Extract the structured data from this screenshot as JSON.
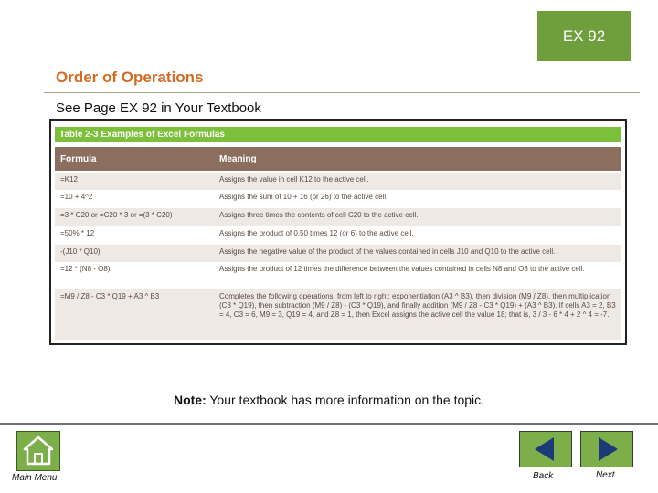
{
  "badge": {
    "text": "EX 92"
  },
  "section_title": "Order of Operations",
  "subtitle": "See Page EX 92 in Your Textbook",
  "table": {
    "title": "Table 2-3 Examples of Excel Formulas",
    "headers": [
      "Formula",
      "Meaning"
    ],
    "rows": [
      {
        "formula": "=K12",
        "meaning": "Assigns the value in cell K12 to the active cell."
      },
      {
        "formula": "=10 + 4^2",
        "meaning": "Assigns the sum of 10 + 16 (or 26) to the active cell."
      },
      {
        "formula": "=3 * C20 or =C20 * 3 or =(3 * C20)",
        "meaning": "Assigns three times the contents of cell C20 to the active cell."
      },
      {
        "formula": "=50% * 12",
        "meaning": "Assigns the product of 0.50 times 12 (or 6) to the active cell."
      },
      {
        "formula": "-(J10 * Q10)",
        "meaning": "Assigns the negative value of the product of the values contained in cells J10 and Q10 to the active cell."
      },
      {
        "formula": "=12 * (N8 - O8)",
        "meaning": "Assigns the product of 12 times the difference between the values contained in cells N8 and O8 to the active cell."
      },
      {
        "formula": "=M9 / Z8 - C3 * Q19 + A3 ^ B3",
        "meaning": "Completes the following operations, from left to right: exponentiation (A3 ^ B3), then division (M9 / Z8), then multiplication (C3 * Q19), then subtraction (M9 / Z8) - (C3 * Q19), and finally addition (M9 / Z8 - C3 * Q19) + (A3 ^ B3). If cells A3 = 2, B3 = 4, C3 = 6, M9 = 3, Q19 = 4, and Z8 = 1, then Excel assigns the active cell the value 18; that is, 3 / 3 - 6 * 4 + 2 ^ 4 = -7."
      }
    ]
  },
  "note": {
    "label": "Note:",
    "text": " Your textbook has more information on the topic."
  },
  "nav": {
    "main_menu": "Main Menu",
    "back": "Back",
    "next": "Next"
  },
  "colors": {
    "accent_green": "#7cae4a",
    "title_orange": "#d46b22",
    "header_brown": "#8c6e5f"
  },
  "icons": {
    "home": "home-icon",
    "back": "left-arrow-icon",
    "next": "right-arrow-icon"
  }
}
